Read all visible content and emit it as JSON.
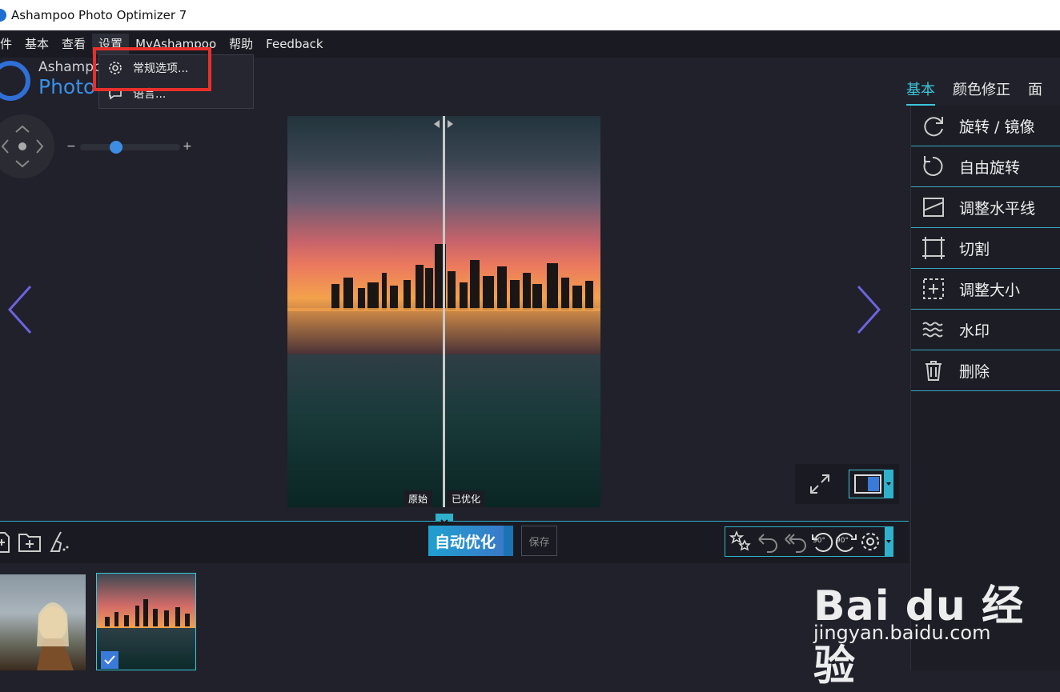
{
  "window": {
    "title": "Ashampoo Photo Optimizer 7"
  },
  "menubar": [
    "件",
    "基本",
    "查看",
    "设置",
    "MyAshampoo",
    "帮助",
    "Feedback"
  ],
  "dropdown": {
    "items": [
      "常规选项...",
      "语言..."
    ]
  },
  "logo": {
    "line1": "Ashampoo",
    "line2": "Photo"
  },
  "zoom": {
    "minus": "−",
    "plus": "+",
    "level_fraction": 0.34
  },
  "compare": {
    "original": "原始",
    "optimized": "已优化"
  },
  "right_tabs": [
    "基本",
    "颜色修正",
    "面"
  ],
  "tools": [
    "旋转 / 镜像",
    "自由旋转",
    "调整水平线",
    "切割",
    "调整大小",
    "水印",
    "删除"
  ],
  "toolbar": {
    "auto_optimize": "自动优化",
    "save": "保存",
    "rotate_badge": "90°"
  },
  "watermark": {
    "brand": "Bai du 经验",
    "url": "jingyan.baidu.com"
  },
  "colors": {
    "accent": "#3cc6dc",
    "highlight": "#e8302b",
    "blue": "#2f6fd6"
  }
}
